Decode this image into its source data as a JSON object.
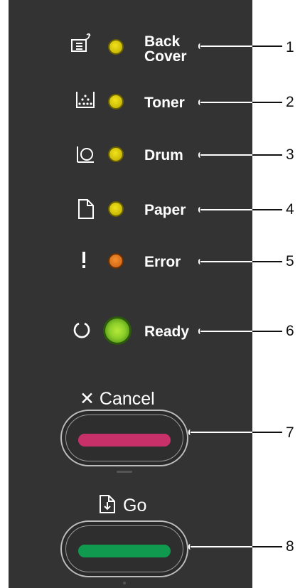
{
  "indicators": [
    {
      "label_line1": "Back",
      "label_line2": "Cover",
      "number": "1",
      "icon": "back-cover-icon",
      "led_color": "#d4c400"
    },
    {
      "label": "Toner",
      "number": "2",
      "icon": "toner-icon",
      "led_color": "#d4c400"
    },
    {
      "label": "Drum",
      "number": "3",
      "icon": "drum-icon",
      "led_color": "#d4c400"
    },
    {
      "label": "Paper",
      "number": "4",
      "icon": "paper-icon",
      "led_color": "#d4c400"
    },
    {
      "label": "Error",
      "number": "5",
      "icon": "exclamation-icon",
      "led_color": "#e0701c"
    },
    {
      "label": "Ready",
      "number": "6",
      "icon": "power-ring-icon",
      "led_color": "#8ccf2a"
    }
  ],
  "buttons": {
    "cancel": {
      "symbol": "✕",
      "label": "Cancel",
      "number": "7",
      "bar_color": "#c8306a"
    },
    "go": {
      "label": "Go",
      "number": "8",
      "bar_color": "#0f9a50",
      "icon": "document-download-icon"
    }
  }
}
